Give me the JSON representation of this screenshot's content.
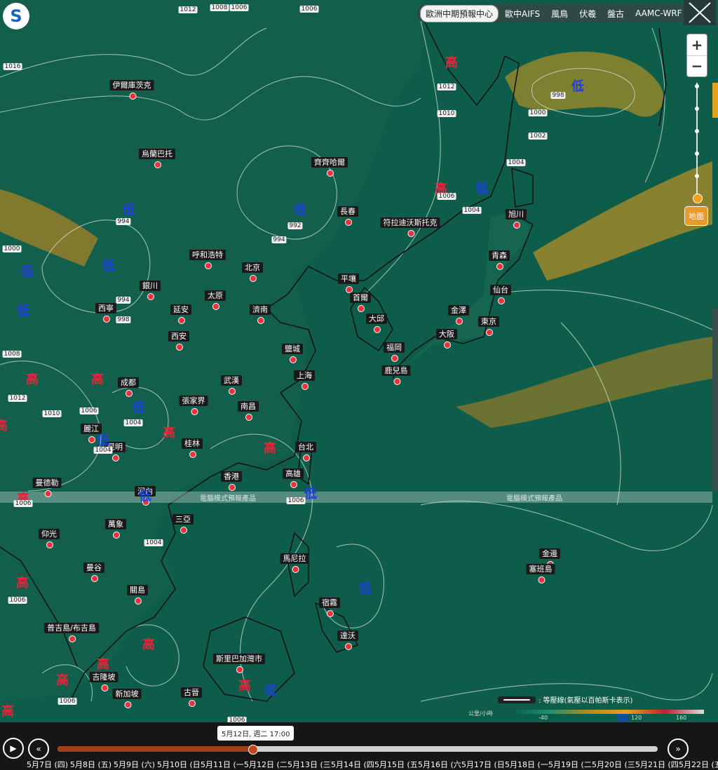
{
  "header": {
    "tabs": [
      {
        "label": "歐洲中期預報中心",
        "active": true
      },
      {
        "label": "歐中AIFS",
        "active": false
      },
      {
        "label": "風鳥",
        "active": false
      },
      {
        "label": "伏羲",
        "active": false
      },
      {
        "label": "盤古",
        "active": false
      },
      {
        "label": "AAMC-WRF",
        "active": false
      }
    ],
    "zoom_in": "+",
    "zoom_out": "−",
    "terrain_button": "地面"
  },
  "banner": {
    "left": "電腦模式預報產品",
    "right": "電腦模式預報產品"
  },
  "cities": [
    {
      "name": "伊爾庫茨克"
    },
    {
      "name": "烏蘭巴托"
    },
    {
      "name": "齊齊哈爾"
    },
    {
      "name": "長春"
    },
    {
      "name": "符拉迪沃斯托克"
    },
    {
      "name": "旭川"
    },
    {
      "name": "呼和浩特"
    },
    {
      "name": "北京"
    },
    {
      "name": "青森"
    },
    {
      "name": "平壤"
    },
    {
      "name": "銀川"
    },
    {
      "name": "太原"
    },
    {
      "name": "首爾"
    },
    {
      "name": "仙台"
    },
    {
      "name": "西寧"
    },
    {
      "name": "延安"
    },
    {
      "name": "濟南"
    },
    {
      "name": "金澤"
    },
    {
      "name": "大邱"
    },
    {
      "name": "東京"
    },
    {
      "name": "西安"
    },
    {
      "name": "大阪"
    },
    {
      "name": "鹽城"
    },
    {
      "name": "福岡"
    },
    {
      "name": "鹿兒島"
    },
    {
      "name": "上海"
    },
    {
      "name": "成都"
    },
    {
      "name": "武漢"
    },
    {
      "name": "張家界"
    },
    {
      "name": "南昌"
    },
    {
      "name": "麗江"
    },
    {
      "name": "昆明"
    },
    {
      "name": "桂林"
    },
    {
      "name": "台北"
    },
    {
      "name": "香港"
    },
    {
      "name": "高雄"
    },
    {
      "name": "曼德勒"
    },
    {
      "name": "河內"
    },
    {
      "name": "三亞"
    },
    {
      "name": "萬象"
    },
    {
      "name": "仰光"
    },
    {
      "name": "馬尼拉"
    },
    {
      "name": "曼谷"
    },
    {
      "name": "金邊"
    },
    {
      "name": "塞班島"
    },
    {
      "name": "關島"
    },
    {
      "name": "宿霧"
    },
    {
      "name": "普吉島/布吉島"
    },
    {
      "name": "達沃"
    },
    {
      "name": "斯里巴加灣市"
    },
    {
      "name": "吉隆坡"
    },
    {
      "name": "新加坡"
    },
    {
      "name": "古晉"
    }
  ],
  "pressure_centers": [
    {
      "type": "high",
      "label": "高"
    },
    {
      "type": "high",
      "label": "高"
    },
    {
      "type": "high",
      "label": "高"
    },
    {
      "type": "high",
      "label": "高"
    },
    {
      "type": "high",
      "label": "高"
    },
    {
      "type": "high",
      "label": "高"
    },
    {
      "type": "high",
      "label": "高"
    },
    {
      "type": "high",
      "label": "高"
    },
    {
      "type": "high",
      "label": "高"
    },
    {
      "type": "high",
      "label": "高"
    },
    {
      "type": "high",
      "label": "高"
    },
    {
      "type": "high",
      "label": "高"
    },
    {
      "type": "high",
      "label": "高"
    },
    {
      "type": "high",
      "label": "高"
    },
    {
      "type": "low",
      "label": "低"
    },
    {
      "type": "low",
      "label": "低"
    },
    {
      "type": "low",
      "label": "低"
    },
    {
      "type": "low",
      "label": "低"
    },
    {
      "type": "low",
      "label": "低"
    },
    {
      "type": "low",
      "label": "低"
    },
    {
      "type": "low",
      "label": "低"
    },
    {
      "type": "low",
      "label": "低"
    },
    {
      "type": "low",
      "label": "低"
    },
    {
      "type": "low",
      "label": "低"
    },
    {
      "type": "low",
      "label": "低"
    },
    {
      "type": "low",
      "label": "低"
    },
    {
      "type": "low",
      "label": "低"
    },
    {
      "type": "low",
      "label": "低"
    }
  ],
  "isobar_labels": [
    "1012",
    "1008",
    "1006",
    "1006",
    "1016",
    "1012",
    "1010",
    "998",
    "1000",
    "1002",
    "1004",
    "1006",
    "1004",
    "994",
    "992",
    "994",
    "1000",
    "994",
    "998",
    "1008",
    "1012",
    "1010",
    "1004",
    "1004",
    "1006",
    "1004",
    "1006",
    "1006",
    "1006",
    "1006",
    "1006"
  ],
  "legend": {
    "isobar_note": ": 等壓線(氣壓以百帕斯卡表示)",
    "unit": "公里/小時",
    "ticks": [
      "-40",
      "120",
      "160"
    ]
  },
  "timeline": {
    "current": "5月12日, 週二 17:00",
    "days": [
      "5月7日 (四)",
      "5月8日 (五)",
      "5月9日 (六)",
      "5月10日 (日)",
      "5月11日 (一)",
      "5月12日 (二)",
      "5月13日 (三)",
      "5月14日 (四)",
      "5月15日 (五)",
      "5月16日 (六)",
      "5月17日 (日)",
      "5月18日 (一)",
      "5月19日 (二)",
      "5月20日 (三)",
      "5月21日 (四)",
      "5月22日 (五)"
    ]
  },
  "colors": {
    "sea": "#0d5a4a",
    "jet": "#e6a020",
    "high": "#e0263a",
    "low": "#1e3fe0",
    "city_dot": "#e8323c"
  }
}
